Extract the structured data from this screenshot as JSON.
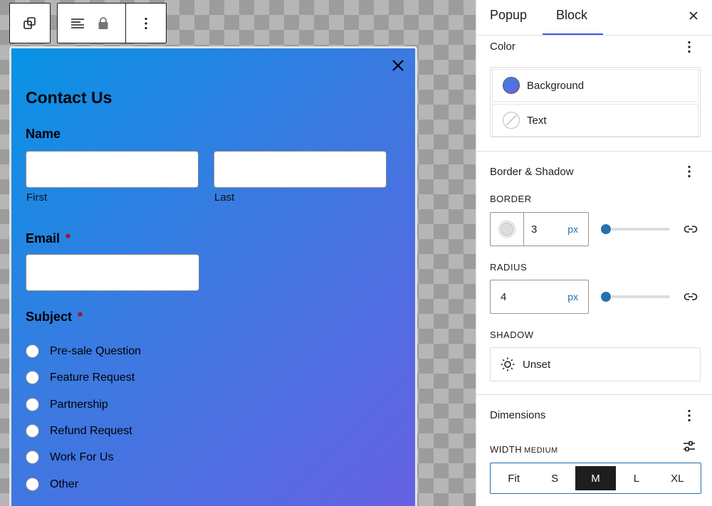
{
  "canvas": {
    "popup": {
      "title": "Contact Us",
      "name_label": "Name",
      "name_first_sublabel": "First",
      "name_last_sublabel": "Last",
      "email_label": "Email",
      "subject_label": "Subject",
      "required_mark": "*",
      "subject_options": [
        "Pre-sale Question",
        "Feature Request",
        "Partnership",
        "Refund Request",
        "Work For Us",
        "Other"
      ],
      "gradient_colors": [
        "#0793e5",
        "#6761e2"
      ]
    }
  },
  "sidebar": {
    "tabs": [
      {
        "label": "Popup",
        "active": false
      },
      {
        "label": "Block",
        "active": true
      }
    ],
    "color_section": {
      "title": "Color",
      "items": [
        {
          "label": "Background",
          "swatch": "#6a74e4"
        },
        {
          "label": "Text",
          "swatch": "none"
        }
      ]
    },
    "border_shadow_section": {
      "title": "Border & Shadow",
      "border_label": "BORDER",
      "border_value": "3",
      "border_unit": "px",
      "radius_label": "RADIUS",
      "radius_value": "4",
      "radius_unit": "px",
      "shadow_label": "SHADOW",
      "shadow_value": "Unset"
    },
    "dimensions_section": {
      "title": "Dimensions",
      "width_label": "WIDTH",
      "width_current": "MEDIUM",
      "width_options": [
        {
          "label": "Fit",
          "active": false
        },
        {
          "label": "S",
          "active": false
        },
        {
          "label": "M",
          "active": true
        },
        {
          "label": "L",
          "active": false
        },
        {
          "label": "XL",
          "active": false
        }
      ]
    },
    "accent_color": "#2271b1"
  }
}
